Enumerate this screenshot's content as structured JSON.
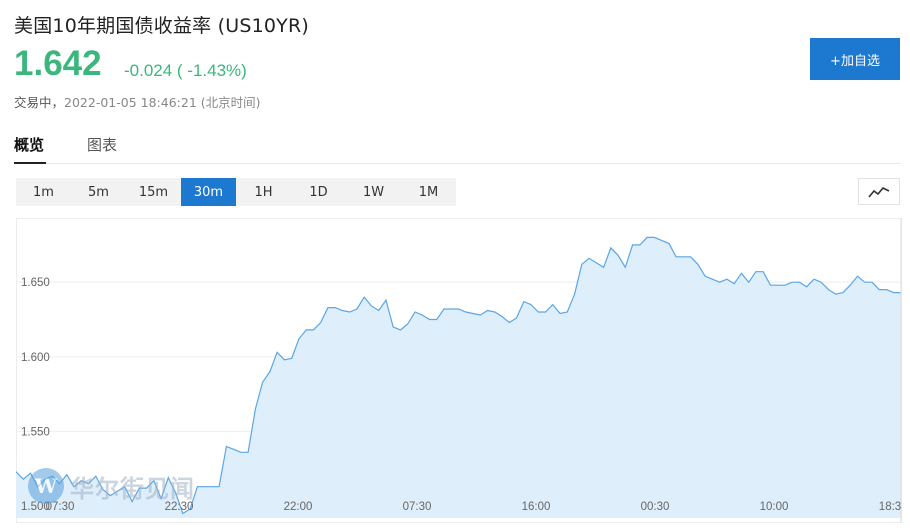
{
  "header": {
    "title": "美国10年期国债收益率  (US10YR)",
    "price": "1.642",
    "change": "-0.024 ( -1.43%)",
    "status": "交易中，",
    "timestamp": "2022-01-05 18:46:21 (北京时间)",
    "watch_label": "+加自选"
  },
  "tabs": [
    {
      "label": "概览",
      "active": true
    },
    {
      "label": "图表",
      "active": false
    }
  ],
  "periods": [
    {
      "label": "1m"
    },
    {
      "label": "5m"
    },
    {
      "label": "15m"
    },
    {
      "label": "30m",
      "active": true
    },
    {
      "label": "1H"
    },
    {
      "label": "1D"
    },
    {
      "label": "1W"
    },
    {
      "label": "1M"
    }
  ],
  "icons": {
    "chart_type": "line-chart-icon"
  },
  "watermark": {
    "text": "华尔街见闻"
  },
  "colors": {
    "accent": "#1d78d0",
    "up_down": "#3bb77e",
    "line": "#5aa6e6",
    "fill": "#deeefb"
  },
  "chart_data": {
    "type": "area",
    "x_ticks": [
      "07:30",
      "22:30",
      "22:00",
      "07:30",
      "16:00",
      "00:30",
      "10:00",
      "18:3"
    ],
    "y_ticks": [
      "1.650",
      "1.600",
      "1.550",
      "1.500"
    ],
    "ylim": [
      1.492,
      1.693
    ],
    "grid": true,
    "values": [
      1.523,
      1.518,
      1.522,
      1.513,
      1.518,
      1.52,
      1.515,
      1.521,
      1.513,
      1.517,
      1.515,
      1.52,
      1.511,
      1.507,
      1.51,
      1.513,
      1.503,
      1.512,
      1.512,
      1.517,
      1.505,
      1.519,
      1.509,
      1.495,
      1.498,
      1.513,
      1.513,
      1.513,
      1.513,
      1.54,
      1.538,
      1.536,
      1.536,
      1.565,
      1.583,
      1.59,
      1.603,
      1.598,
      1.599,
      1.612,
      1.618,
      1.618,
      1.623,
      1.633,
      1.633,
      1.631,
      1.63,
      1.632,
      1.64,
      1.634,
      1.631,
      1.638,
      1.62,
      1.618,
      1.622,
      1.63,
      1.628,
      1.625,
      1.625,
      1.632,
      1.632,
      1.632,
      1.63,
      1.629,
      1.628,
      1.631,
      1.63,
      1.627,
      1.623,
      1.626,
      1.637,
      1.635,
      1.63,
      1.63,
      1.635,
      1.629,
      1.63,
      1.642,
      1.662,
      1.666,
      1.663,
      1.66,
      1.673,
      1.668,
      1.66,
      1.675,
      1.675,
      1.68,
      1.68,
      1.678,
      1.676,
      1.667,
      1.667,
      1.667,
      1.662,
      1.654,
      1.652,
      1.65,
      1.652,
      1.649,
      1.656,
      1.65,
      1.657,
      1.657,
      1.648,
      1.648,
      1.648,
      1.65,
      1.65,
      1.647,
      1.652,
      1.65,
      1.645,
      1.642,
      1.643,
      1.648,
      1.654,
      1.65,
      1.65,
      1.645,
      1.645,
      1.643,
      1.643
    ]
  }
}
